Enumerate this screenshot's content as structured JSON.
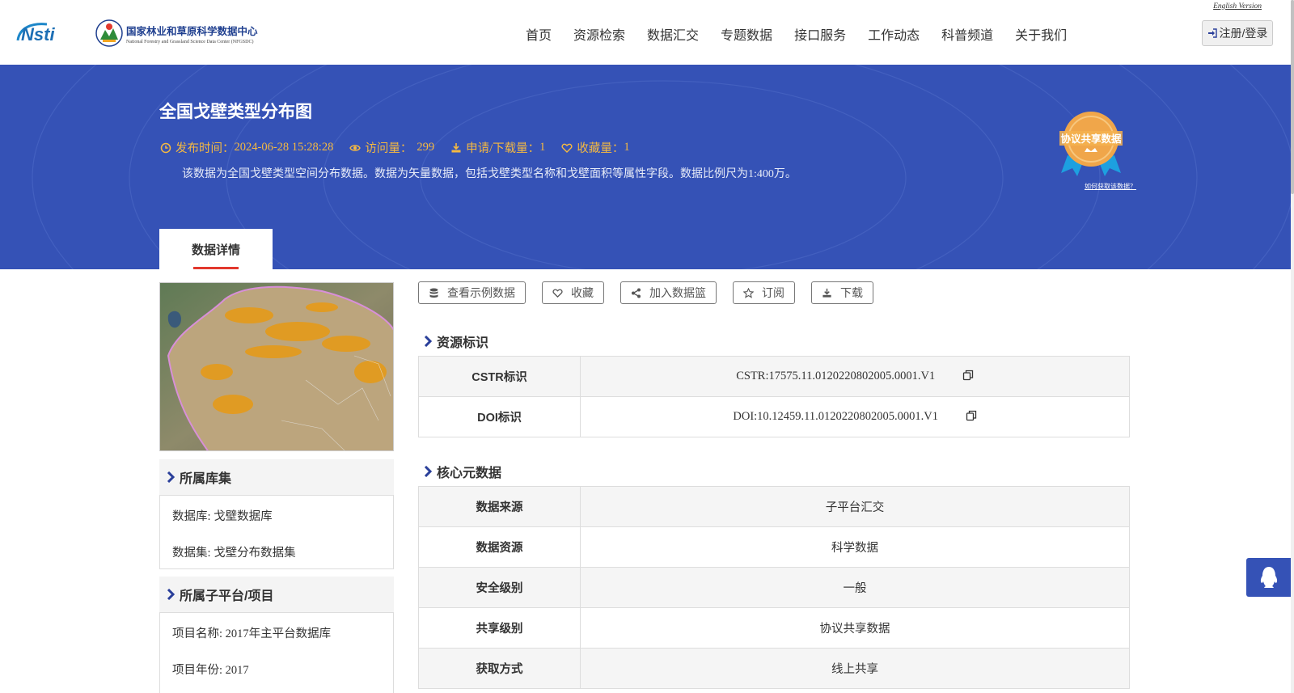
{
  "header": {
    "nsti_logo_text": "Nsti",
    "center_name_cn": "国家林业和草原科学数据中心",
    "center_name_en": "National Forestry and Grassland Science Data Center (NFGSDC)",
    "english_version": "English Version",
    "login_label": "注册/登录",
    "nav": [
      "首页",
      "资源检索",
      "数据汇交",
      "专题数据",
      "接口服务",
      "工作动态",
      "科普频道",
      "关于我们"
    ]
  },
  "hero": {
    "title": "全国戈壁类型分布图",
    "publish_label": "发布时间：",
    "publish_time": "2024-06-28 15:28:28",
    "views_label": "访问量：",
    "views": "299",
    "downloads_label": "申请/下载量：",
    "downloads": "1",
    "favorites_label": "收藏量：",
    "favorites": "1",
    "description": "该数据为全国戈壁类型空间分布数据。数据为矢量数据，包括戈壁类型名称和戈壁面积等属性字段。数据比例尺为1:400万。",
    "badge_text": "协议共享数据",
    "badge_link": "如何获取该数据？",
    "tab_label": "数据详情"
  },
  "sidebar": {
    "library_title": "所属库集",
    "database_line": "数据库: 戈壁数据库",
    "dataset_line": "数据集: 戈壁分布数据集",
    "project_title": "所属子平台/项目",
    "project_name_line": "项目名称: 2017年主平台数据库",
    "project_year_line": "项目年份: 2017"
  },
  "actions": [
    "查看示例数据",
    "收藏",
    "加入数据篮",
    "订阅",
    "下载"
  ],
  "resource_id": {
    "title": "资源标识",
    "rows": [
      {
        "key": "CSTR标识",
        "value": "CSTR:17575.11.0120220802005.0001.V1"
      },
      {
        "key": "DOI标识",
        "value": "DOI:10.12459.11.0120220802005.0001.V1"
      }
    ]
  },
  "core_meta": {
    "title": "核心元数据",
    "rows": [
      {
        "key": "数据来源",
        "value": "子平台汇交"
      },
      {
        "key": "数据资源",
        "value": "科学数据"
      },
      {
        "key": "安全级别",
        "value": "一般"
      },
      {
        "key": "共享级别",
        "value": "协议共享数据"
      },
      {
        "key": "获取方式",
        "value": "线上共享"
      }
    ]
  },
  "colors": {
    "hero_bg": "#3552b6",
    "meta_accent": "#f5b941",
    "tab_underline": "#e2382d",
    "chevron": "#2a3f9a"
  }
}
